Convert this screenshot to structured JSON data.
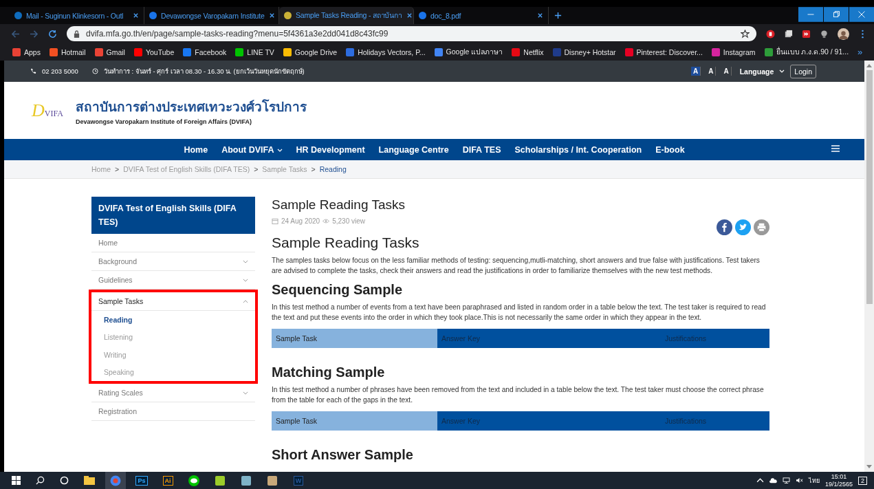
{
  "browser": {
    "tabs": [
      {
        "title": "Mail - Suginun Klinkesorn - Outl",
        "selected": false,
        "color": "#0f6cbd"
      },
      {
        "title": "Devawongse Varopakarn Institute",
        "selected": false,
        "color": "#1a73e8"
      },
      {
        "title": "Sample Tasks Reading - สถาบันกา",
        "selected": true,
        "color": "#c9b037"
      },
      {
        "title": "doc_8.pdf",
        "selected": false,
        "color": "#1a73e8"
      }
    ],
    "address": "dvifa.mfa.go.th/en/page/sample-tasks-reading?menu=5f4361a3e2dd041d8c43fc99",
    "bookmarks": [
      {
        "label": "Apps",
        "color": "#e94235"
      },
      {
        "label": "Hotmail",
        "color": "#f25022"
      },
      {
        "label": "Gmail",
        "color": "#ea4335"
      },
      {
        "label": "YouTube",
        "color": "#ff0000"
      },
      {
        "label": "Facebook",
        "color": "#1877f2"
      },
      {
        "label": "LINE TV",
        "color": "#00c300"
      },
      {
        "label": "Google Drive",
        "color": "#fbbc04"
      },
      {
        "label": "Holidays Vectors, P...",
        "color": "#2d6cdf"
      },
      {
        "label": "Google แปลภาษา",
        "color": "#4285f4"
      },
      {
        "label": "Netflix",
        "color": "#e50914"
      },
      {
        "label": "Disney+ Hotstar",
        "color": "#1f3b8a"
      },
      {
        "label": "Pinterest: Discover...",
        "color": "#e60023"
      },
      {
        "label": "Instagram",
        "color": "#d6249f"
      },
      {
        "label": "ยื่นแบบ ภ.ง.ด.90 / 91...",
        "color": "#2e9d3a"
      }
    ],
    "more": "»"
  },
  "topbar": {
    "phone": "02 203 5000",
    "hours": "วันทำการ : จันทร์ - ศุกร์ เวลา 08.30 - 16.30 น. (ยกเว้นวันหยุดนักขัตฤกษ์)",
    "font_sizes": [
      {
        "label": "A",
        "selected": true
      },
      {
        "label": "A",
        "selected": false
      },
      {
        "label": "A",
        "selected": false
      }
    ],
    "language": "Language",
    "login": "Login"
  },
  "header": {
    "logo_initial": "D",
    "logo_rest": "VIFA",
    "title": "สถาบันการต่างประเทศเทวะวงศ์วโรปการ",
    "subtitle": "Devawongse Varopakarn Institute of Foreign Affairs (DVIFA)"
  },
  "nav": [
    {
      "label": "Home",
      "dropdown": false
    },
    {
      "label": "About DVIFA",
      "dropdown": true
    },
    {
      "label": "HR Development",
      "dropdown": false
    },
    {
      "label": "Language Centre",
      "dropdown": false
    },
    {
      "label": "DIFA TES",
      "dropdown": false
    },
    {
      "label": "Scholarships / Int. Cooperation",
      "dropdown": false
    },
    {
      "label": "E-book",
      "dropdown": false
    }
  ],
  "breadcrumb": [
    {
      "label": "Home",
      "selected": false
    },
    {
      "separator": ">",
      "label": "DVIFA Test of English Skills (DIFA TES)",
      "selected": false
    },
    {
      "separator": ">",
      "label": "Sample Tasks",
      "selected": false
    },
    {
      "separator": ">",
      "label": "Reading",
      "selected": true
    }
  ],
  "sidebar": {
    "title": "DVIFA Test of English Skills (DIFA TES)",
    "items": [
      {
        "label": "Home",
        "has_children": false,
        "expanded": false,
        "highlighted": false
      },
      {
        "label": "Background",
        "has_children": true,
        "expanded": false,
        "highlighted": false
      },
      {
        "label": "Guidelines",
        "has_children": true,
        "expanded": false,
        "highlighted": false
      },
      {
        "label": "Sample Tasks",
        "has_children": true,
        "expanded": true,
        "highlighted": true,
        "children": [
          {
            "label": "Reading",
            "selected": true
          },
          {
            "label": "Listening",
            "selected": false
          },
          {
            "label": "Writing",
            "selected": false
          },
          {
            "label": "Speaking",
            "selected": false
          }
        ]
      },
      {
        "label": "Rating Scales",
        "has_children": true,
        "expanded": false,
        "highlighted": false
      },
      {
        "label": "Registration",
        "has_children": false,
        "expanded": false,
        "highlighted": false
      }
    ]
  },
  "article": {
    "title": "Sample Reading Tasks",
    "date": "24 Aug 2020",
    "views": "5,230 view",
    "heading": "Sample Reading Tasks",
    "intro": "The samples tasks below focus on the less familiar methods of testing: sequencing,mutli-matching, short answers and true false with justifications. Test takers are advised to complete the tasks, check their answers and read the justifications in order to familiarize themselves with the new test methods.",
    "sections": [
      {
        "title": "Sequencing Sample",
        "text": "In this test method a number of events from a text have been paraphrased and listed in random order in a table below the text. The test taker is required to read the text and put these events into the order in which they took place.This is not necessarily the same order in which they appear in the text.",
        "columns": [
          "Sample Task",
          "Answer Key",
          "Justifications"
        ]
      },
      {
        "title": "Matching Sample",
        "text": "In this test method a number of phrases have been removed from the text and included in a table below the text. The test taker must choose the correct phrase from the table for each of the gaps in the text.",
        "columns": [
          "Sample Task",
          "Answer Key",
          "Justifications"
        ]
      },
      {
        "title": "Short Answer Sample"
      }
    ]
  },
  "taskbar": {
    "apps": [
      {
        "kind": "explorer",
        "color": "#f4c542",
        "selected": false
      },
      {
        "kind": "chrome",
        "color": "#4285f4",
        "selected": true
      },
      {
        "kind": "badge",
        "label": "Ps",
        "color": "#31a8ff",
        "selected": false
      },
      {
        "kind": "badge",
        "label": "Ai",
        "color": "#ff9a00",
        "selected": false
      },
      {
        "kind": "line",
        "color": "#00c300",
        "selected": false
      },
      {
        "kind": "app",
        "color": "#9ccc2a",
        "selected": false
      },
      {
        "kind": "app",
        "color": "#7fb3c8",
        "selected": false
      },
      {
        "kind": "app",
        "color": "#c8a87a",
        "selected": false
      },
      {
        "kind": "badge",
        "label": "W",
        "color": "#2b579a",
        "selected": false
      }
    ],
    "language": "ไทย",
    "time": "15:01",
    "date": "19/1/2565",
    "notifications": "2"
  }
}
